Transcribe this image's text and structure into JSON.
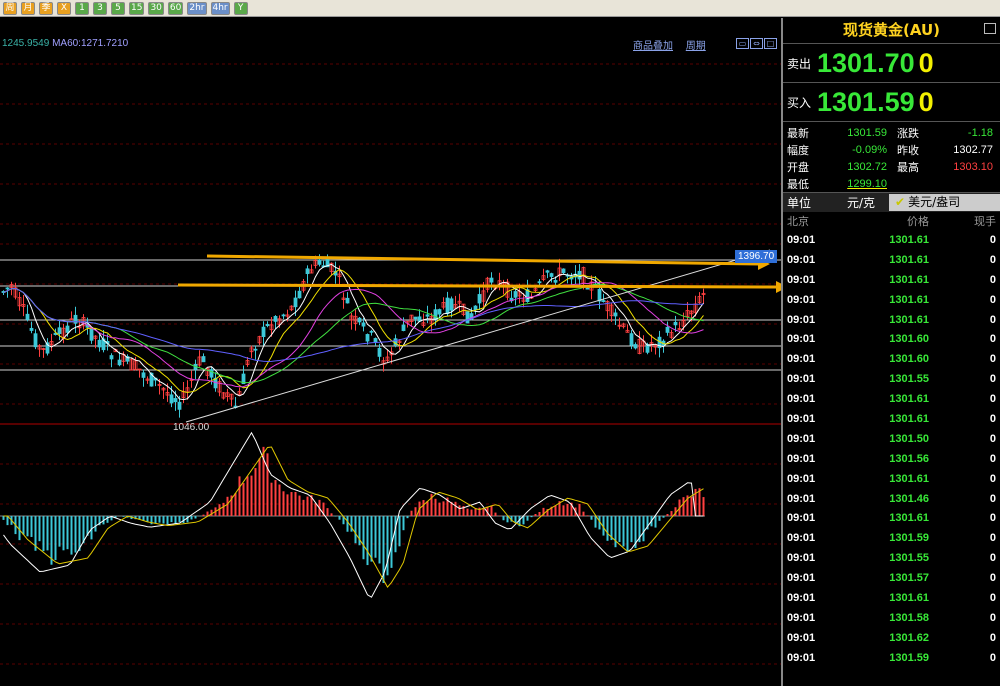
{
  "toolbar": {
    "buttons": [
      {
        "label": "周",
        "color": "orange",
        "name": "period-week-button"
      },
      {
        "label": "月",
        "color": "orange",
        "name": "period-month-button"
      },
      {
        "label": "季",
        "color": "orange",
        "name": "period-quarter-button"
      },
      {
        "label": "X",
        "color": "orange",
        "name": "period-x-button"
      },
      {
        "label": "1",
        "color": "green",
        "name": "period-1min-button"
      },
      {
        "label": "3",
        "color": "green",
        "name": "period-3min-button"
      },
      {
        "label": "5",
        "color": "green",
        "name": "period-5min-button"
      },
      {
        "label": "15",
        "color": "green",
        "name": "period-15min-button"
      },
      {
        "label": "30",
        "color": "green",
        "name": "period-30min-button"
      },
      {
        "label": "60",
        "color": "green",
        "name": "period-60min-button"
      },
      {
        "label": "2hr",
        "color": "blue",
        "name": "period-2hr-button"
      },
      {
        "label": "4hr",
        "color": "blue",
        "name": "period-4hr-button"
      },
      {
        "label": "Y",
        "color": "green",
        "name": "period-year-button"
      }
    ]
  },
  "chart": {
    "ma_text_1": "1245.9549",
    "ma_text_2": "MA60:1271.7210",
    "link_overlay": "商品叠加",
    "link_period": "周期",
    "price_tag": "1396.70",
    "low_label": "1046.00",
    "colors": {
      "bull": "#ff4040",
      "bear": "#3cc8d8",
      "arrow": "#f0a800",
      "trend": "#dddddd"
    }
  },
  "panel": {
    "title": "现货黄金(AU)",
    "sell_label": "卖出",
    "sell_price": "1301.70",
    "sell_vol": "0",
    "buy_label": "买入",
    "buy_price": "1301.59",
    "buy_vol": "0",
    "stats": [
      {
        "l1": "最新",
        "v1": "1301.59",
        "c1": "green",
        "l2": "涨跌",
        "v2": "-1.18",
        "c2": "green"
      },
      {
        "l1": "幅度",
        "v1": "-0.09%",
        "c1": "green",
        "l2": "昨收",
        "v2": "1302.77",
        "c2": "white"
      },
      {
        "l1": "开盘",
        "v1": "1302.72",
        "c1": "green",
        "l2": "最高",
        "v2": "1303.10",
        "c2": "red"
      },
      {
        "l1": "最低",
        "v1": "1299.10",
        "c1": "green",
        "l2": "",
        "v2": "",
        "c2": "white"
      }
    ],
    "unit_label": "单位",
    "unit_value": "元/克",
    "unit_option": "美元/盎司",
    "tick_headers": {
      "time": "北京",
      "price": "价格",
      "vol": "现手"
    },
    "ticks": [
      {
        "t": "09:01",
        "p": "1301.61",
        "v": "0"
      },
      {
        "t": "09:01",
        "p": "1301.61",
        "v": "0"
      },
      {
        "t": "09:01",
        "p": "1301.61",
        "v": "0"
      },
      {
        "t": "09:01",
        "p": "1301.61",
        "v": "0"
      },
      {
        "t": "09:01",
        "p": "1301.61",
        "v": "0"
      },
      {
        "t": "09:01",
        "p": "1301.60",
        "v": "0"
      },
      {
        "t": "09:01",
        "p": "1301.60",
        "v": "0"
      },
      {
        "t": "09:01",
        "p": "1301.55",
        "v": "0"
      },
      {
        "t": "09:01",
        "p": "1301.61",
        "v": "0"
      },
      {
        "t": "09:01",
        "p": "1301.61",
        "v": "0"
      },
      {
        "t": "09:01",
        "p": "1301.50",
        "v": "0"
      },
      {
        "t": "09:01",
        "p": "1301.56",
        "v": "0"
      },
      {
        "t": "09:01",
        "p": "1301.61",
        "v": "0"
      },
      {
        "t": "09:01",
        "p": "1301.46",
        "v": "0"
      },
      {
        "t": "09:01",
        "p": "1301.61",
        "v": "0"
      },
      {
        "t": "09:01",
        "p": "1301.59",
        "v": "0"
      },
      {
        "t": "09:01",
        "p": "1301.55",
        "v": "0"
      },
      {
        "t": "09:01",
        "p": "1301.57",
        "v": "0"
      },
      {
        "t": "09:01",
        "p": "1301.61",
        "v": "0"
      },
      {
        "t": "09:01",
        "p": "1301.58",
        "v": "0"
      },
      {
        "t": "09:01",
        "p": "1301.62",
        "v": "0"
      },
      {
        "t": "09:01",
        "p": "1301.59",
        "v": "0"
      }
    ]
  }
}
